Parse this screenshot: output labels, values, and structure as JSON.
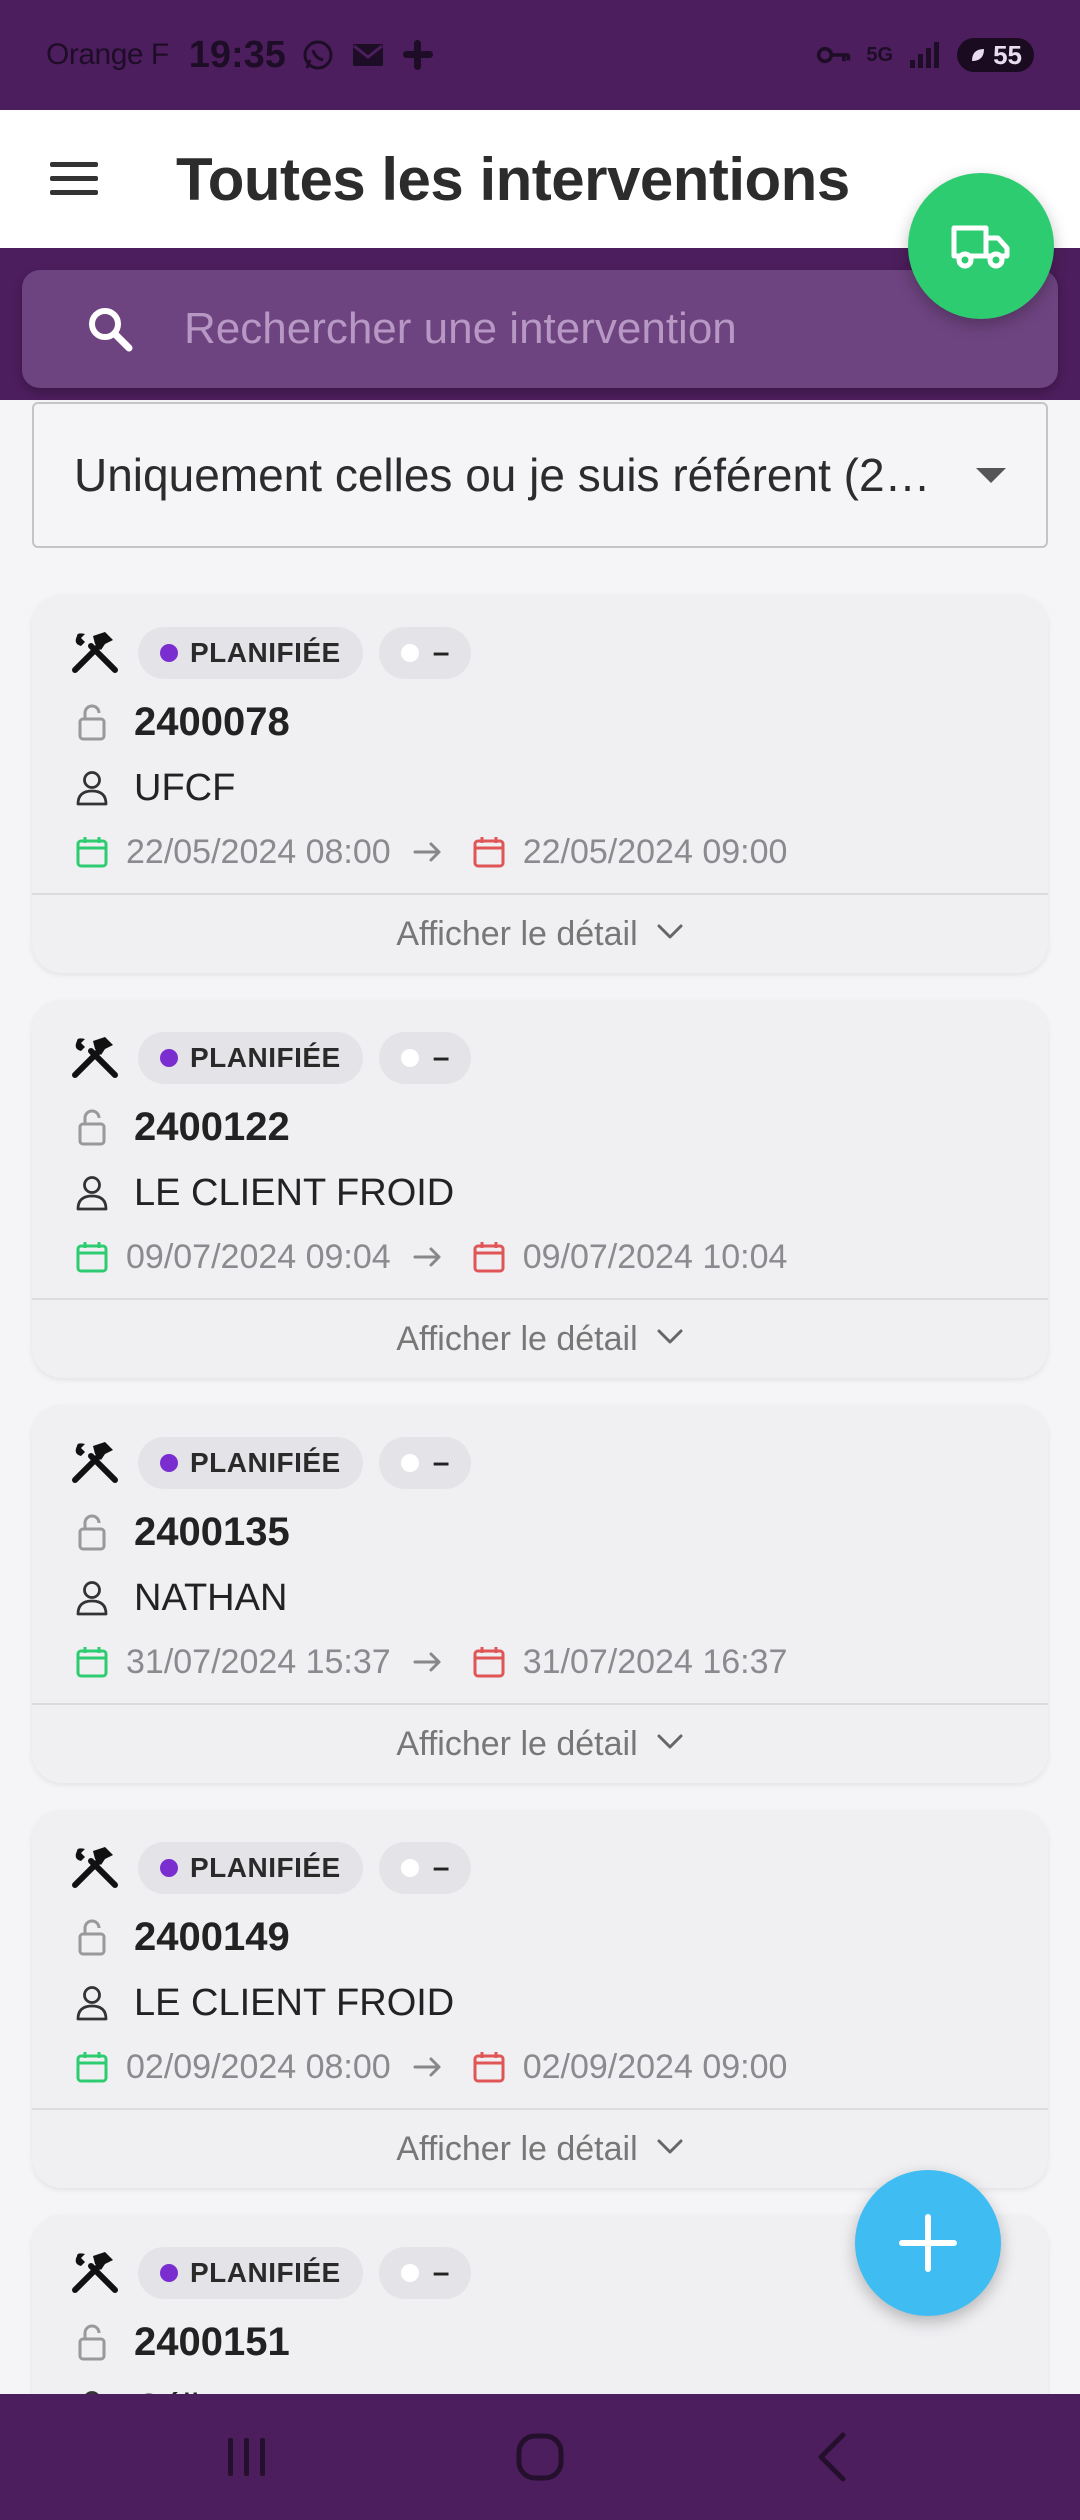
{
  "status_bar": {
    "carrier": "Orange F",
    "time": "19:35",
    "network": "5G",
    "battery": "55"
  },
  "app_bar": {
    "title": "Toutes les interventions"
  },
  "search": {
    "placeholder": "Rechercher une intervention"
  },
  "filter": {
    "selected": "Uniquement celles ou je suis référent (2…"
  },
  "colors": {
    "brand": "#4d1e5d",
    "fab_truck": "#2ecc71",
    "fab_add": "#3fbdf2",
    "status_dot": "#7b2ed0",
    "start_date_icon": "#2ecc71",
    "end_date_icon": "#e05555"
  },
  "interventions": [
    {
      "status": "PLANIFIÉE",
      "priority": "–",
      "ref": "2400078",
      "client": "UFCF",
      "start": "22/05/2024 08:00",
      "end": "22/05/2024 09:00",
      "detail_label": "Afficher le détail"
    },
    {
      "status": "PLANIFIÉE",
      "priority": "–",
      "ref": "2400122",
      "client": "LE CLIENT FROID",
      "start": "09/07/2024 09:04",
      "end": "09/07/2024 10:04",
      "detail_label": "Afficher le détail"
    },
    {
      "status": "PLANIFIÉE",
      "priority": "–",
      "ref": "2400135",
      "client": "NATHAN",
      "start": "31/07/2024 15:37",
      "end": "31/07/2024 16:37",
      "detail_label": "Afficher le détail"
    },
    {
      "status": "PLANIFIÉE",
      "priority": "–",
      "ref": "2400149",
      "client": "LE CLIENT FROID",
      "start": "02/09/2024 08:00",
      "end": "02/09/2024 09:00",
      "detail_label": "Afficher le détail"
    },
    {
      "status": "PLANIFIÉE",
      "priority": "–",
      "ref": "2400151",
      "client": "Céline",
      "start": "",
      "end": "",
      "detail_label": ""
    }
  ]
}
